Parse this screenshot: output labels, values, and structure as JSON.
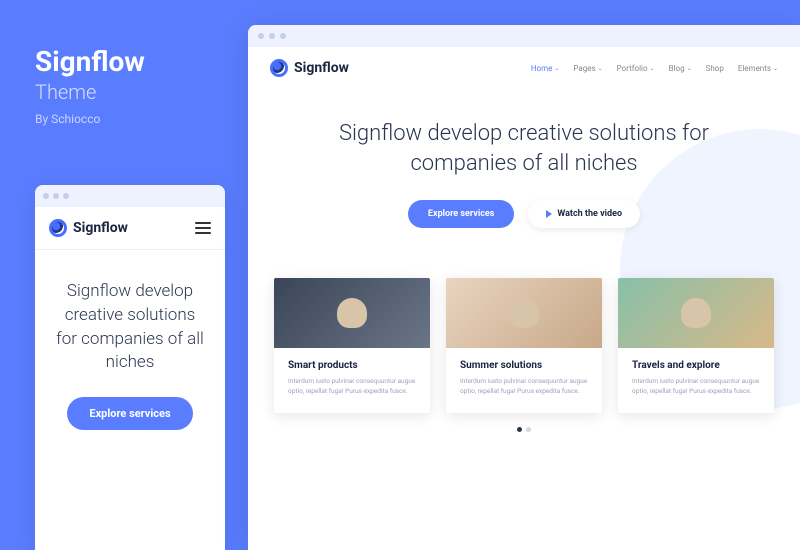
{
  "theme": {
    "title": "Signflow",
    "subtitle": "Theme",
    "author": "By Schiocco"
  },
  "brand": {
    "name": "Signflow"
  },
  "nav": {
    "items": [
      {
        "label": "Home",
        "active": true
      },
      {
        "label": "Pages",
        "active": false
      },
      {
        "label": "Portfolio",
        "active": false
      },
      {
        "label": "Blog",
        "active": false
      },
      {
        "label": "Shop",
        "active": false
      },
      {
        "label": "Elements",
        "active": false
      }
    ]
  },
  "hero": {
    "headline": "Signflow develop creative solutions for companies of all niches",
    "cta_primary": "Explore services",
    "cta_secondary": "Watch the video"
  },
  "cards": [
    {
      "title": "Smart products",
      "desc": "Interdum iusto pulvinar consequuntur augue optio, repellat fuga! Purus expedita fusce."
    },
    {
      "title": "Summer solutions",
      "desc": "Interdum iusto pulvinar consequuntur augue optio, repellat fuga! Purus expedita fusce."
    },
    {
      "title": "Travels and explore",
      "desc": "Interdum iusto pulvinar consequuntur augue optio, repellat fuga! Purus expedita fusce."
    }
  ],
  "colors": {
    "primary": "#5a7dff",
    "dark": "#1a2540"
  }
}
